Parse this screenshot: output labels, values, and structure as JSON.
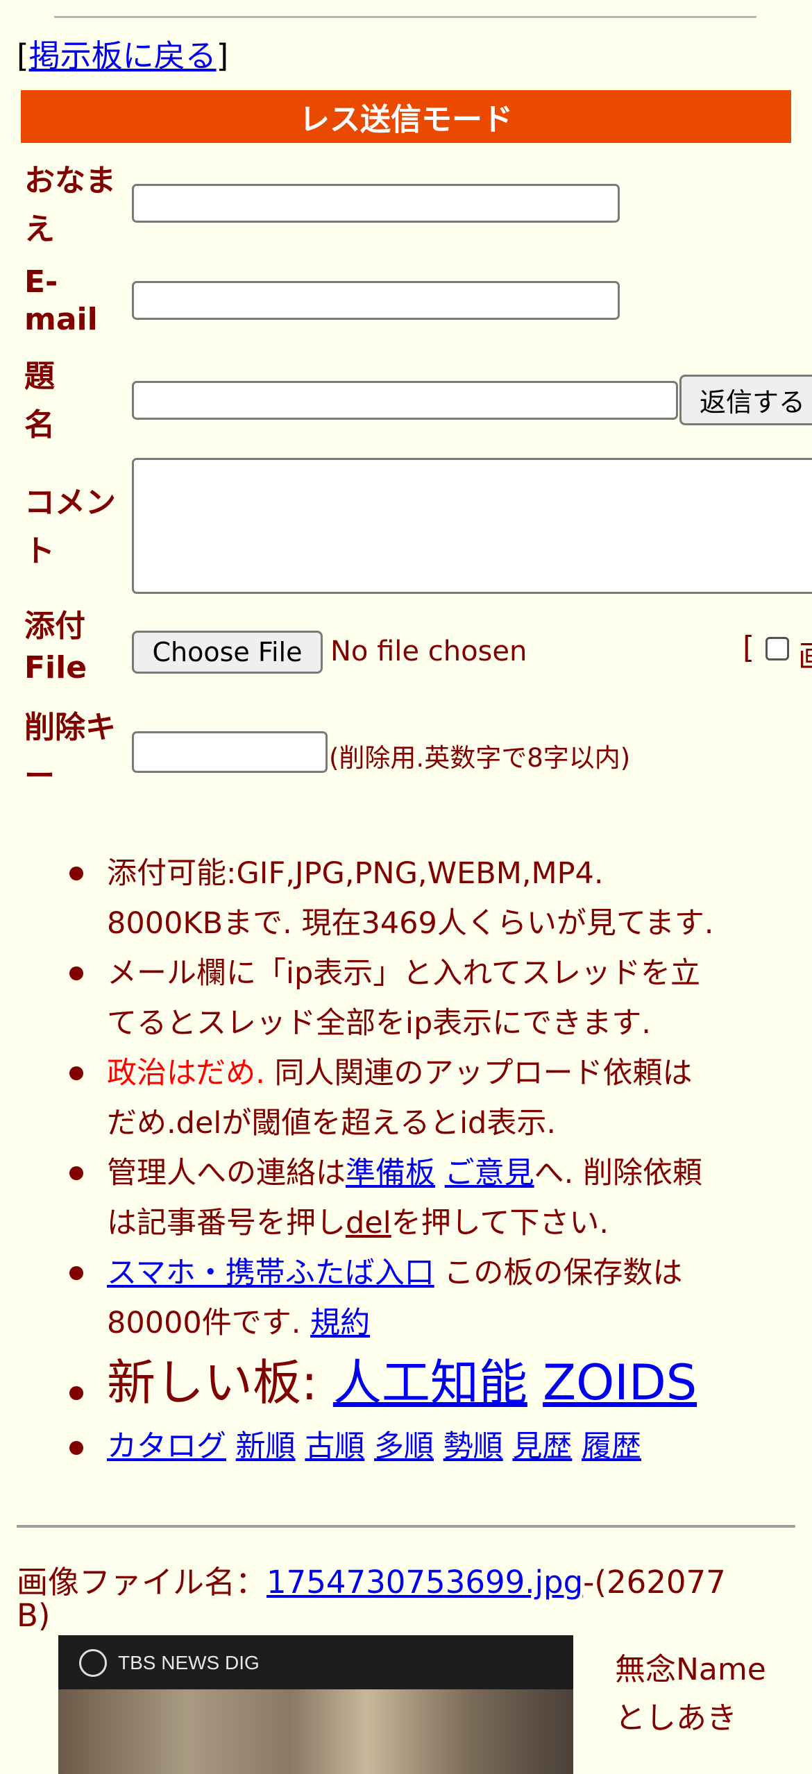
{
  "back_link": {
    "open": "[",
    "label": "掲示板に戻る",
    "close": "]"
  },
  "banner": "レス送信モード",
  "form": {
    "name_label": "おなま え",
    "email_label": "E- mail",
    "subject_label": "題 名",
    "comment_label": "コメン ト",
    "attach_label": "添付 File",
    "delkey_label": "削除キ ー",
    "reply_button": "返信する",
    "choose_file": "Choose File",
    "no_file": "No file chosen",
    "image_option_bracket": "[",
    "image_option_char": "画",
    "delkey_note": "(削除用.英数字で8字以内)"
  },
  "notices": {
    "n1_l1": "添付可能:GIF,JPG,PNG,WEBM,MP4.",
    "n1_l2": "8000KBまで. 現在3469人くらいが見てます.",
    "n2_l1": "メール欄に「ip表示」と入れてスレッドを立",
    "n2_l2": "てるとスレッド全部をip表示にできます.",
    "n3_red": "政治はだめ.",
    "n3_l1": " 同人関連のアップロード依頼は",
    "n3_l2": "だめ.delが閾値を超えるとid表示.",
    "n4_a": "管理人への連絡は",
    "n4_link1": "準備板",
    "n4_link2": "ご意見",
    "n4_b": "へ. 削除依頼",
    "n4_c": "は記事番号を押し",
    "n4_link3": "del",
    "n4_d": "を押して下さい.",
    "n5_link": "スマホ・携帯ふたば入口",
    "n5_a": " この板の保存数は",
    "n5_b": "80000件です.",
    "n5_link2": "規約",
    "n6_label": "新しい板:",
    "n6_link1": "人工知能",
    "n6_link2": "ZOIDS",
    "nav": [
      "カタログ",
      "新順",
      "古順",
      "多順",
      "勢順",
      "見歴",
      "履歴"
    ]
  },
  "post": {
    "file_label": "画像ファイル名：",
    "file_name": "1754730753699.jpg",
    "file_size_l1": "-(262077",
    "file_size_l2": "B)",
    "thumb_brand": "TBS NEWS DIG",
    "poster_name": "無念Name",
    "poster_text": "としあき"
  }
}
